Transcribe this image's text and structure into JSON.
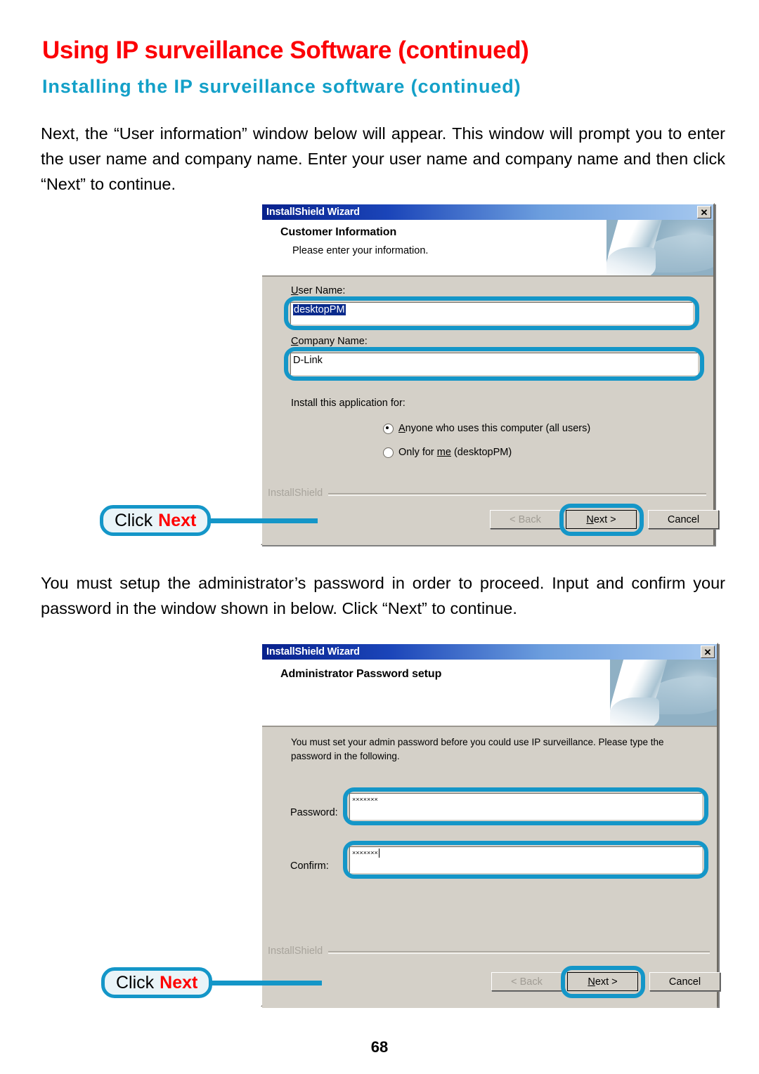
{
  "page": {
    "title": "Using IP surveillance Software (continued)",
    "subtitle": "Installing the IP surveillance software (continued)",
    "paragraph_1": "Next, the “User information” window below will appear. This window will prompt you to enter the user name and company name. Enter your user name and company name and then click “Next” to continue.",
    "paragraph_2": "You must setup the administrator’s password in order to proceed. Input and confirm your password in the window shown in below. Click “Next” to continue.",
    "page_number": "68",
    "title_color": "#fc0006",
    "subtitle_color": "#13a0c8",
    "annotation_color": "#1496c8"
  },
  "callouts": [
    {
      "prefix": "Click",
      "emphasis": "Next"
    },
    {
      "prefix": "Click",
      "emphasis": "Next"
    }
  ],
  "dialog_customer": {
    "window_title": "InstallShield Wizard",
    "close_label": "✕",
    "heading": "Customer Information",
    "subheading": "Please enter your information.",
    "user_name_label_first": "U",
    "user_name_label_rest": "ser Name:",
    "user_name_value": "desktopPM",
    "company_name_label_first": "C",
    "company_name_label_rest": "ompany Name:",
    "company_name_value": "D-Link",
    "install_for_label": "Install this application for:",
    "radios": [
      {
        "pre": "",
        "accel": "A",
        "post": "nyone who uses this computer (all users)",
        "checked": true
      },
      {
        "pre": "Only for ",
        "accel": "me",
        "post": " (desktopPM)",
        "checked": false
      }
    ],
    "brand": "InstallShield",
    "buttons": {
      "back": "< Back",
      "next_accel": "N",
      "next_rest": "ext >",
      "cancel": "Cancel"
    }
  },
  "dialog_password": {
    "window_title": "InstallShield Wizard",
    "close_label": "✕",
    "heading": "Administrator Password setup",
    "instruction": "You must set your admin password before you could use IP surveillance. Please type the password in the following.",
    "password_label": "Password:",
    "password_value": "×××××××",
    "confirm_label": "Confirm:",
    "confirm_value": "×××××××",
    "brand": "InstallShield",
    "buttons": {
      "back": "< Back",
      "next_accel": "N",
      "next_rest": "ext >",
      "cancel": "Cancel"
    }
  }
}
